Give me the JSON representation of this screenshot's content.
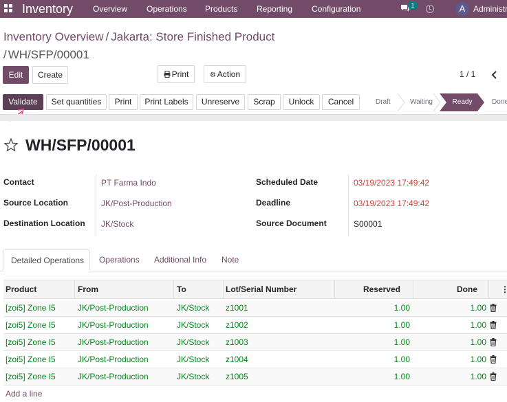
{
  "nav": {
    "app_title": "Inventory",
    "menu": [
      "Overview",
      "Operations",
      "Products",
      "Reporting",
      "Configuration"
    ],
    "chat_badge": "1",
    "user_initial": "A",
    "user_name": "Administrator"
  },
  "breadcrumb": {
    "parent": "Inventory Overview",
    "section": "Jakarta: Store Finished Product",
    "current": "WH/SFP/00001"
  },
  "control": {
    "edit": "Edit",
    "create": "Create",
    "print": "Print",
    "action": "Action",
    "pager": "1 / 1"
  },
  "actions": {
    "validate": "Validate",
    "set_quantities": "Set quantities",
    "print": "Print",
    "print_labels": "Print Labels",
    "unreserve": "Unreserve",
    "scrap": "Scrap",
    "unlock": "Unlock",
    "cancel": "Cancel"
  },
  "stages": [
    "Draft",
    "Waiting",
    "Ready",
    "Done"
  ],
  "active_stage": "Ready",
  "record": {
    "name": "WH/SFP/00001",
    "fields_left": [
      {
        "label": "Contact",
        "value": "PT Farma Indo"
      },
      {
        "label": "Source Location",
        "value": "JK/Post-Production"
      },
      {
        "label": "Destination Location",
        "value": "JK/Stock"
      }
    ],
    "fields_right": [
      {
        "label": "Scheduled Date",
        "value": "03/19/2023 17:49:42"
      },
      {
        "label": "Deadline",
        "value": "03/19/2023 17:49:42"
      },
      {
        "label": "Source Document",
        "value": "S00001"
      }
    ]
  },
  "tabs": [
    "Detailed Operations",
    "Operations",
    "Additional Info",
    "Note"
  ],
  "table": {
    "columns": [
      "Product",
      "From",
      "To",
      "Lot/Serial Number",
      "Reserved",
      "Done"
    ],
    "rows": [
      [
        "[zoi5] Zone I5",
        "JK/Post-Production",
        "JK/Stock",
        "z1001",
        "1.00",
        "1.00"
      ],
      [
        "[zoi5] Zone I5",
        "JK/Post-Production",
        "JK/Stock",
        "z1002",
        "1.00",
        "1.00"
      ],
      [
        "[zoi5] Zone I5",
        "JK/Post-Production",
        "JK/Stock",
        "z1003",
        "1.00",
        "1.00"
      ],
      [
        "[zoi5] Zone I5",
        "JK/Post-Production",
        "JK/Stock",
        "z1004",
        "1.00",
        "1.00"
      ],
      [
        "[zoi5] Zone I5",
        "JK/Post-Production",
        "JK/Stock",
        "z1005",
        "1.00",
        "1.00"
      ]
    ],
    "add_line": "Add a line"
  },
  "colors": {
    "brand": "#714b67",
    "ready_stage": "#714b67",
    "row_text": "#008818",
    "date_red": "#d23f3a",
    "annotation_arrow": "#e83e8c"
  }
}
